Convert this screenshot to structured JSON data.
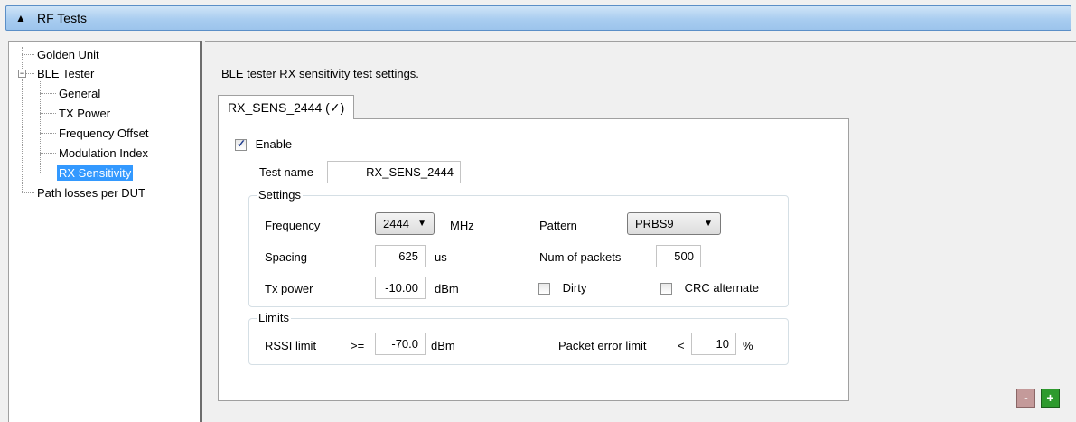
{
  "header": {
    "title": "RF Tests",
    "collapse_icon": "triangle-up-icon"
  },
  "tree": {
    "items": [
      {
        "label": "Golden Unit"
      },
      {
        "label": "BLE Tester"
      },
      {
        "label": "General"
      },
      {
        "label": "TX Power"
      },
      {
        "label": "Frequency Offset"
      },
      {
        "label": "Modulation Index"
      },
      {
        "label": "RX Sensitivity",
        "selected": true
      },
      {
        "label": "Path losses per DUT"
      }
    ],
    "expander_symbol": "−"
  },
  "main": {
    "description": "BLE tester RX sensitivity test settings.",
    "tab_label": "RX_SENS_2444 (✓)",
    "enable_label": "Enable",
    "enable_checked": true,
    "test_name_label": "Test name",
    "test_name_value": "RX_SENS_2444",
    "settings": {
      "title": "Settings",
      "frequency_label": "Frequency",
      "frequency_value": "2444",
      "frequency_unit": "MHz",
      "pattern_label": "Pattern",
      "pattern_value": "PRBS9",
      "spacing_label": "Spacing",
      "spacing_value": "625",
      "spacing_unit": "us",
      "num_packets_label": "Num of packets",
      "num_packets_value": "500",
      "tx_power_label": "Tx power",
      "tx_power_value": "-10.00",
      "tx_power_unit": "dBm",
      "dirty_label": "Dirty",
      "dirty_checked": false,
      "crc_label": "CRC alternate",
      "crc_checked": false
    },
    "limits": {
      "title": "Limits",
      "rssi_label": "RSSI limit",
      "rssi_op": ">=",
      "rssi_value": "-70.0",
      "rssi_unit": "dBm",
      "per_label": "Packet error limit",
      "per_op": "<",
      "per_value": "10",
      "per_unit": "%"
    }
  },
  "buttons": {
    "remove_label": "-",
    "add_label": "+",
    "remove_color": "#c49a9a",
    "add_color": "#2e9a2e"
  }
}
